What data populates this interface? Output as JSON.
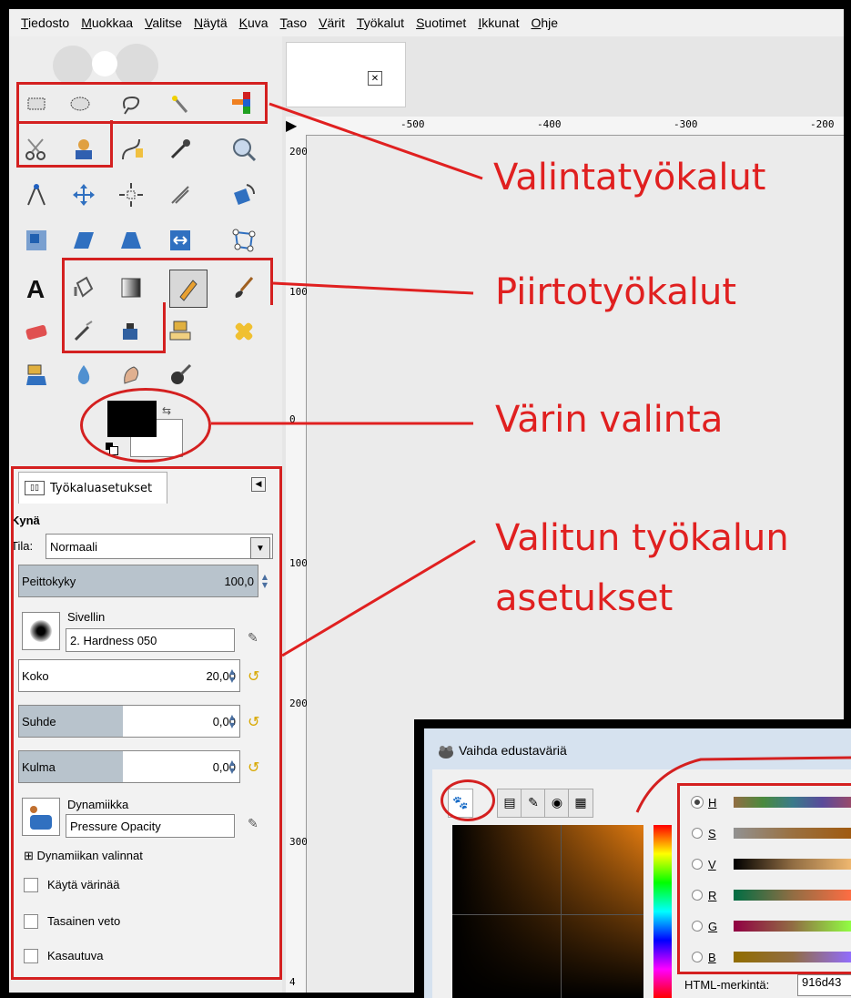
{
  "menu": [
    "Tiedosto",
    "Muokkaa",
    "Valitse",
    "Näytä",
    "Kuva",
    "Taso",
    "Värit",
    "Työkalut",
    "Suotimet",
    "Ikkunat",
    "Ohje"
  ],
  "annotations": {
    "selection_tools": "Valintatyökalut",
    "paint_tools": "Piirtotyökalut",
    "color_select": "Värin valinta",
    "tool_options_1": "Valitun työkalun",
    "tool_options_2": "asetukset"
  },
  "tool_options": {
    "tab_title": "Työkaluasetukset",
    "tool_name": "Kynä",
    "mode_label": "Tila:",
    "mode_value": "Normaali",
    "opacity_label": "Peittokyky",
    "opacity_value": "100,0",
    "opacity_fraction": 1.0,
    "brush_label": "Sivellin",
    "brush_value": "2. Hardness 050",
    "size_label": "Koko",
    "size_value": "20,00",
    "ratio_label": "Suhde",
    "ratio_value": "0,00",
    "angle_label": "Kulma",
    "angle_value": "0,00",
    "dynamics_label": "Dynamiikka",
    "dynamics_value": "Pressure Opacity",
    "dynamics_options": "Dynamiikan valinnat",
    "use_color": "Käytä värinää",
    "smooth_stroke": "Tasainen veto",
    "incremental": "Kasautuva"
  },
  "ruler": {
    "h_labels": [
      "-500",
      "-400",
      "-300",
      "-200"
    ],
    "v_labels": [
      "200",
      "100",
      "0",
      "100",
      "200",
      "300",
      "4"
    ]
  },
  "dialog": {
    "title": "Vaihda edustaväriä",
    "channels": [
      "H",
      "S",
      "V",
      "R",
      "G",
      "B"
    ],
    "html_label": "HTML-merkintä:",
    "html_value": "916d43"
  },
  "colors": {
    "annotation_red": "#e02020",
    "foreground": "#000000",
    "background": "#ffffff"
  }
}
